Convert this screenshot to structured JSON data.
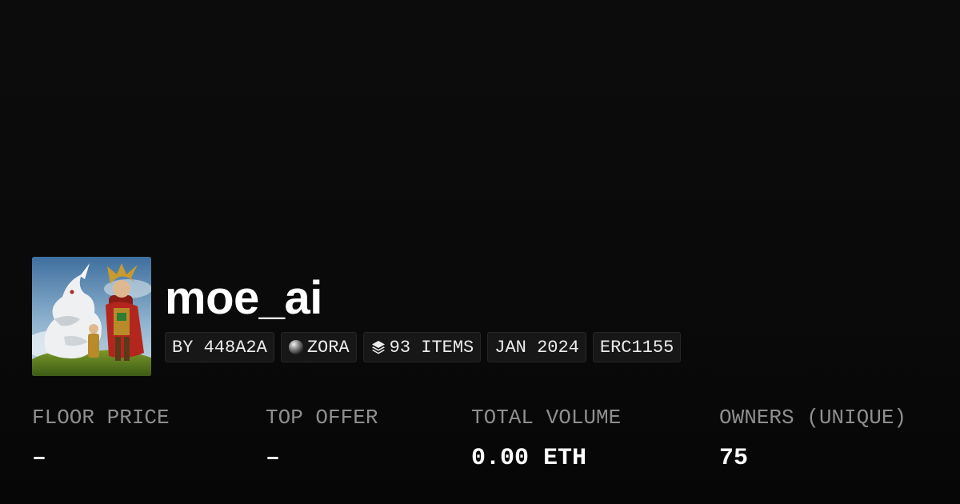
{
  "collection": {
    "name": "moe_ai",
    "avatar_icon": "fantasy-dragon-warrior-artwork"
  },
  "tags": {
    "creator": "BY 448A2A",
    "chain": "ZORA",
    "chain_icon": "zora-orb-icon",
    "items": "93 ITEMS",
    "items_icon": "layers-icon",
    "date": "JAN 2024",
    "standard": "ERC1155"
  },
  "stats": [
    {
      "label": "FLOOR PRICE",
      "value": "–"
    },
    {
      "label": "TOP OFFER",
      "value": "–"
    },
    {
      "label": "TOTAL VOLUME",
      "value": "0.00 ETH"
    },
    {
      "label": "OWNERS (UNIQUE)",
      "value": "75"
    }
  ],
  "colors": {
    "background": "#0a0a0a",
    "label": "#8e8e8e",
    "tag_bg": "#171717",
    "tag_border": "#262626"
  }
}
